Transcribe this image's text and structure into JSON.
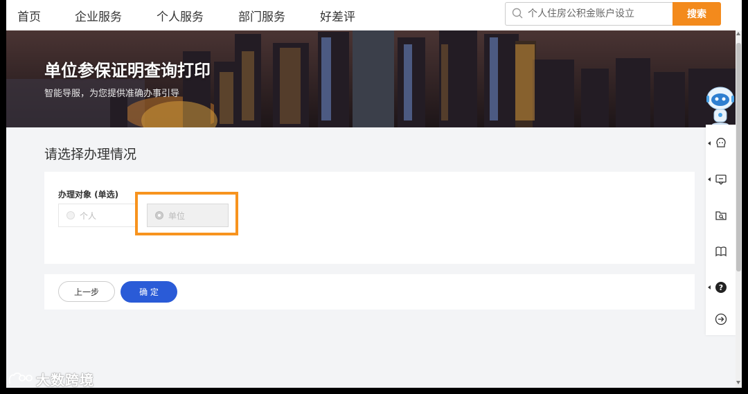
{
  "nav": {
    "items": [
      "首页",
      "企业服务",
      "个人服务",
      "部门服务",
      "好差评"
    ]
  },
  "search": {
    "value": "个人住房公积金账户设立",
    "button_label": "搜索",
    "button_color": "#f38a1c"
  },
  "banner": {
    "title": "单位参保证明查询打印",
    "subtitle": "智能导服，为您提供准确办事引导"
  },
  "main": {
    "section_title": "请选择办理情况",
    "field_label": "办理对象 (单选)",
    "options": [
      {
        "label": "个人",
        "selected": false
      },
      {
        "label": "单位",
        "selected": true
      }
    ],
    "highlight_color": "#f7931e"
  },
  "actions": {
    "prev_label": "上一步",
    "confirm_label": "确 定",
    "confirm_color": "#2a5bd7"
  },
  "sidebar": {
    "icons": [
      "robot-assistant-icon",
      "consult-icon",
      "message-icon",
      "folder-search-icon",
      "book-icon",
      "help-icon",
      "exit-arrow-icon"
    ]
  },
  "watermark": {
    "text": "大数跨境"
  }
}
